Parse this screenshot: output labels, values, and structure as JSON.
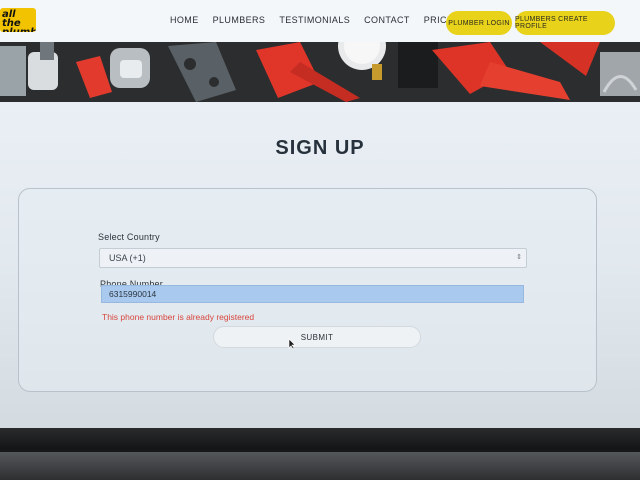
{
  "header": {
    "logo_text": "all the plumber",
    "nav": [
      "HOME",
      "PLUMBERS",
      "TESTIMONIALS",
      "CONTACT",
      "PRICING"
    ],
    "login_label": "PLUMBER LOGIN",
    "create_label": "PLUMBERS CREATE PROFILE"
  },
  "hero": {
    "image": "plumbing-tools-banner"
  },
  "form": {
    "title": "SIGN UP",
    "country_label": "Select Country",
    "country_value": "USA (+1)",
    "phone_label": "Phone Number",
    "phone_value": "6315990014",
    "error": "This phone number is already registered",
    "submit_label": "SUBMIT"
  },
  "colors": {
    "accent": "#e8d21a",
    "error": "#d8463d",
    "phone_highlight": "#a9c9ee"
  }
}
